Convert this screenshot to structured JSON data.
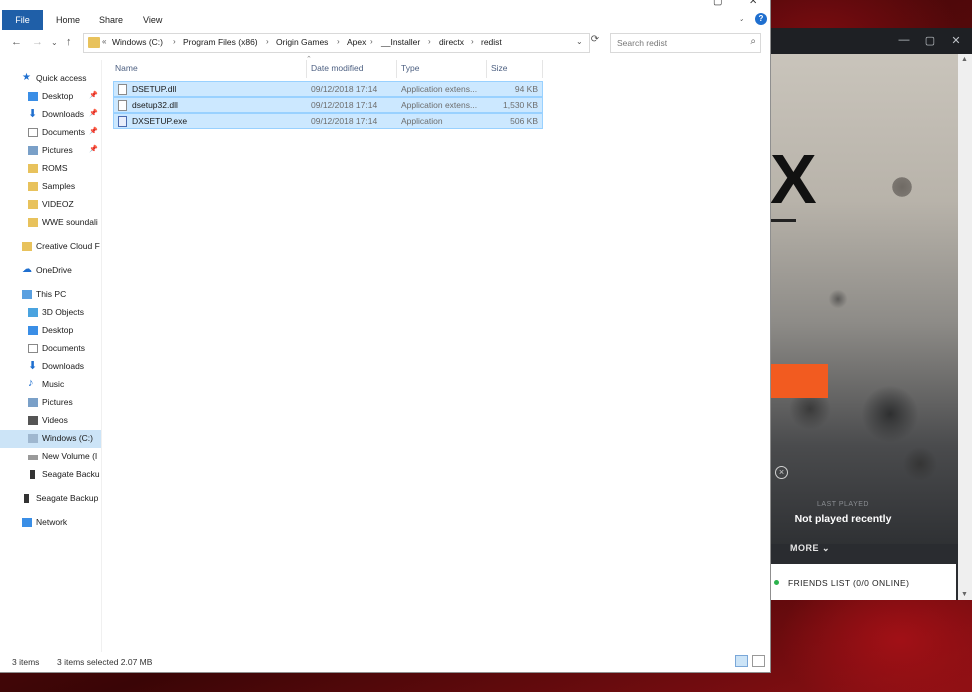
{
  "explorer": {
    "title": "redist",
    "ribbon_tabs": [
      "File",
      "Home",
      "Share",
      "View"
    ],
    "address_parts": [
      "Windows (C:)",
      "Program Files (x86)",
      "Origin Games",
      "Apex",
      "__Installer",
      "directx",
      "redist"
    ],
    "search_placeholder": "Search redist",
    "nav": {
      "quick_access": "Quick access",
      "qa_items": [
        "Desktop",
        "Downloads",
        "Documents",
        "Pictures",
        "ROMS",
        "Samples",
        "VIDEOZ",
        "WWE soundali"
      ],
      "creative_cloud": "Creative Cloud F",
      "onedrive": "OneDrive",
      "this_pc": "This PC",
      "pc_items": [
        "3D Objects",
        "Desktop",
        "Documents",
        "Downloads",
        "Music",
        "Pictures",
        "Videos",
        "Windows (C:)",
        "New Volume (I",
        "Seagate Backu"
      ],
      "seagate": "Seagate Backup",
      "network": "Network"
    },
    "columns": [
      "Name",
      "Date modified",
      "Type",
      "Size"
    ],
    "files": [
      {
        "name": "DSETUP.dll",
        "date": "09/12/2018 17:14",
        "type": "Application extens...",
        "size": "94 KB"
      },
      {
        "name": "dsetup32.dll",
        "date": "09/12/2018 17:14",
        "type": "Application extens...",
        "size": "1,530 KB"
      },
      {
        "name": "DXSETUP.exe",
        "date": "09/12/2018 17:14",
        "type": "Application",
        "size": "506 KB"
      }
    ],
    "status": {
      "items": "3 items",
      "selected": "3 items selected 2.07 MB"
    }
  },
  "origin": {
    "last_played_label": "LAST PLAYED",
    "last_played_value": "Not played recently",
    "more": "MORE",
    "friends": "FRIENDS LIST (0/0 ONLINE)",
    "art_letter": "X"
  },
  "colors": {
    "file_tab": "#1f5fa8",
    "selection": "#cce8ff",
    "origin_accent": "#f25b20",
    "online_dot": "#2bb24c"
  }
}
